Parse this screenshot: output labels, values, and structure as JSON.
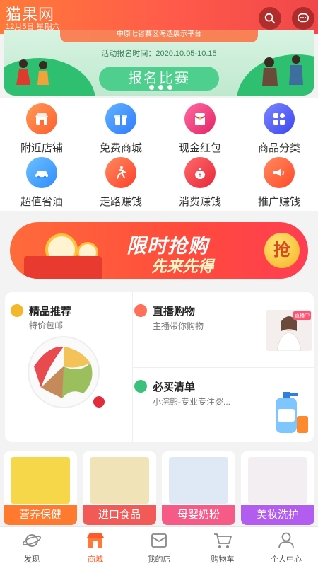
{
  "header": {
    "title": "猫果网",
    "date": "12月5日 星期六"
  },
  "banner": {
    "top_text": "中原七省赛区海选展示平台",
    "time_text": "活动报名时间：2020.10.05-10.15",
    "button_label": "报名比赛"
  },
  "categories": [
    {
      "label": "附近店铺",
      "icon": "store-icon",
      "color": "#ff6d3a"
    },
    {
      "label": "免费商城",
      "icon": "gift-icon",
      "color": "#3a8dff"
    },
    {
      "label": "现金红包",
      "icon": "red-envelope-icon",
      "color": "#f0357a"
    },
    {
      "label": "商品分类",
      "icon": "category-icon",
      "color": "#4d5cff"
    },
    {
      "label": "超值省油",
      "icon": "car-icon",
      "color": "#3aa2ff"
    },
    {
      "label": "走路赚钱",
      "icon": "walking-icon",
      "color": "#ff5b3a"
    },
    {
      "label": "消费赚钱",
      "icon": "money-bag-icon",
      "color": "#f23c4a"
    },
    {
      "label": "推广赚钱",
      "icon": "megaphone-icon",
      "color": "#ff5c3a"
    }
  ],
  "promo": {
    "title": "限时抢购",
    "subtitle": "先来先得",
    "button": "抢"
  },
  "features": {
    "recommend": {
      "title": "精品推荐",
      "subtitle": "特价包邮"
    },
    "live": {
      "title": "直播购物",
      "subtitle": "主播带你购物",
      "tag": "直播中"
    },
    "must_buy": {
      "title": "必买清单",
      "subtitle": "小浣熊-专业专注婴..."
    }
  },
  "tiles": [
    {
      "label": "营养保健",
      "color": "#ff7a2e"
    },
    {
      "label": "进口食品",
      "color": "#f25a57"
    },
    {
      "label": "母婴奶粉",
      "color": "#f65b88"
    },
    {
      "label": "美妆洗护",
      "color": "#b35cf0"
    }
  ],
  "tabs": [
    {
      "label": "发现"
    },
    {
      "label": "商城"
    },
    {
      "label": "我的店"
    },
    {
      "label": "购物车"
    },
    {
      "label": "个人中心"
    }
  ]
}
